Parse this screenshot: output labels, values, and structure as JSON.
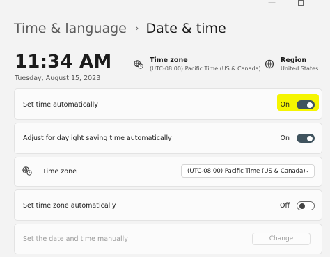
{
  "breadcrumb": {
    "parent": "Time & language",
    "separator": "›",
    "current": "Date & time"
  },
  "clock": {
    "time": "11:34 AM",
    "date": "Tuesday, August 15, 2023"
  },
  "info": {
    "timezone": {
      "label": "Time zone",
      "value": "(UTC-08:00) Pacific Time (US & Canada)",
      "icon": "clock-globe-icon"
    },
    "region": {
      "label": "Region",
      "value": "United States",
      "icon": "globe-icon"
    }
  },
  "settings": {
    "set_time_auto": {
      "label": "Set time automatically",
      "state": "On",
      "enabled": true
    },
    "daylight_saving": {
      "label": "Adjust for daylight saving time automatically",
      "state": "On",
      "enabled": true
    },
    "timezone_select": {
      "label": "Time zone",
      "selected": "(UTC-08:00) Pacific Time (US & Canada)"
    },
    "set_timezone_auto": {
      "label": "Set time zone automatically",
      "state": "Off",
      "enabled": false
    },
    "manual": {
      "label": "Set the date and time manually",
      "button": "Change"
    }
  },
  "colors": {
    "toggle_on": "#40535e",
    "highlight": "#f5f500",
    "background": "#f3f3f3"
  }
}
